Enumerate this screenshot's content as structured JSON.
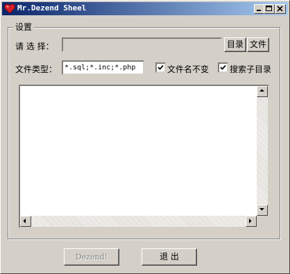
{
  "window": {
    "title": "Mr.Dezend Sheel",
    "icon": "heart-icon"
  },
  "settings": {
    "group_label": "设置",
    "select_label": "请 选 择：",
    "path_value": "",
    "dir_button": "目录",
    "file_button": "文件",
    "filetype_label": "文件类型：",
    "filetype_value": "*.sql;*.inc;*.php",
    "keep_name_label": "文件名不变",
    "keep_name_checked": true,
    "search_subdirs_label": "搜索子目录",
    "search_subdirs_checked": true
  },
  "actions": {
    "dezend_label": "Dezend!",
    "exit_label": "退 出"
  },
  "colors": {
    "title_start": "#0a246a",
    "title_end": "#a6caf0",
    "face": "#d4d0c8"
  }
}
